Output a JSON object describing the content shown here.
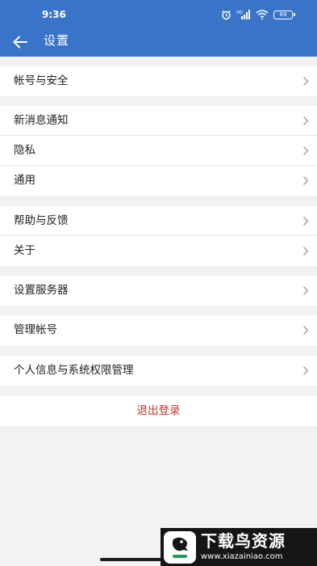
{
  "status_bar": {
    "time": "9:36",
    "battery": "89",
    "icons": [
      "alarm-icon",
      "hd-signal-icon",
      "wifi-icon",
      "battery-icon"
    ]
  },
  "header": {
    "title": "设置",
    "back_icon": "arrow-left-icon"
  },
  "colors": {
    "header": "#3a74c9",
    "background": "#f2f2f2",
    "logout": "#c0392b"
  },
  "settings": {
    "groups": [
      {
        "items": [
          {
            "label": "帐号与安全"
          }
        ]
      },
      {
        "items": [
          {
            "label": "新消息通知"
          },
          {
            "label": "隐私"
          },
          {
            "label": "通用"
          }
        ]
      },
      {
        "items": [
          {
            "label": "帮助与反馈"
          },
          {
            "label": "关于"
          }
        ]
      },
      {
        "items": [
          {
            "label": "设置服务器"
          }
        ]
      },
      {
        "items": [
          {
            "label": "管理帐号"
          }
        ]
      },
      {
        "items": [
          {
            "label": "个人信息与系统权限管理"
          }
        ]
      }
    ],
    "logout_label": "退出登录"
  },
  "watermark": {
    "name": "下载鸟资源",
    "domain": "www.xiazainiao.com"
  }
}
